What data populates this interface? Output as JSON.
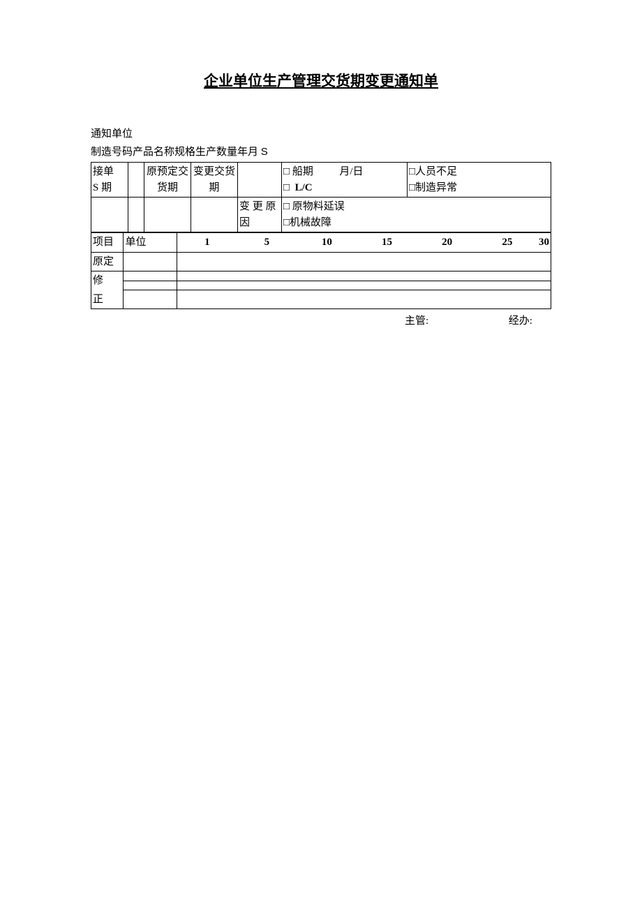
{
  "title": "企业单位生产管理交货期变更通知单",
  "info": {
    "line1": "通知单位",
    "line2_prefix": "制造号码产品名称规格生产数量年月",
    "line2_suffix": "S"
  },
  "table1": {
    "r1c1a": "接单",
    "r1c1b": "S 期",
    "r1c3a": "原预定交",
    "r1c3b": "货期",
    "r1c4a": "变更交货",
    "r1c4b": "期",
    "r1_reason1_box": "□",
    "r1_reason1": "船期",
    "r1_month_day": "月/日",
    "r1_reason2_box": "□",
    "r1_reason2": "L/C",
    "r1_reason3": "□人员不足",
    "r1_reason4": "□制造异常",
    "r2_label": "变 更 原因",
    "r2_reason1": "□ 原物料延误",
    "r2_reason2": "□机械故障"
  },
  "table2": {
    "header": {
      "c1": "项目",
      "c2": "单位",
      "n1": "1",
      "n5": "5",
      "n10": "10",
      "n15": "15",
      "n20": "20",
      "n25": "25",
      "n30": "30"
    },
    "row1": "原定",
    "row2": "修",
    "row3": "正"
  },
  "footer": {
    "supervisor": "主管:",
    "handler": "经办:"
  }
}
